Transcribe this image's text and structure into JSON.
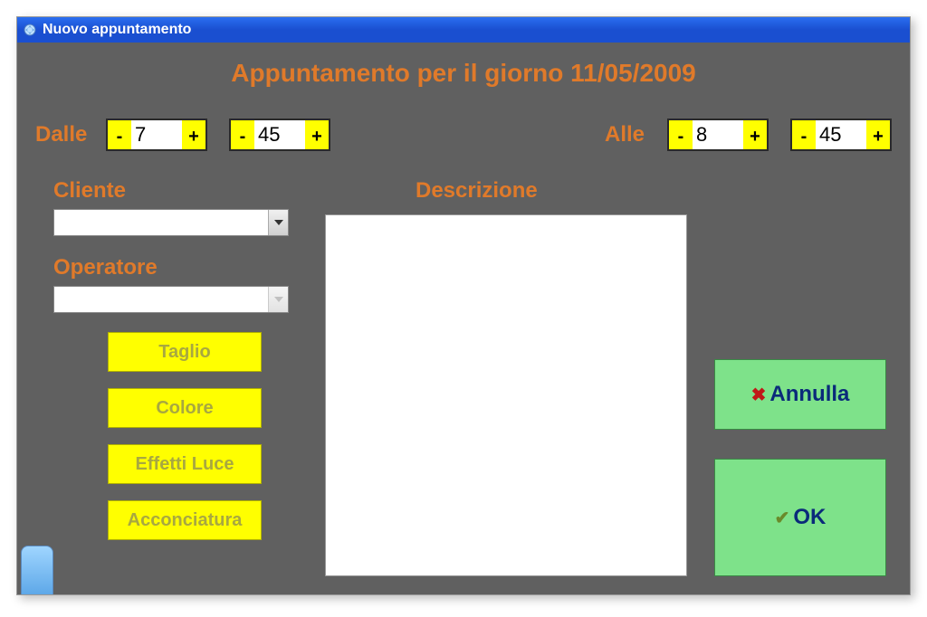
{
  "window": {
    "title": "Nuovo appuntamento"
  },
  "heading": "Appuntamento per il giorno 11/05/2009",
  "labels": {
    "dalle": "Dalle",
    "alle": "Alle",
    "cliente": "Cliente",
    "operatore": "Operatore",
    "descrizione": "Descrizione"
  },
  "time": {
    "from_hour": "7",
    "from_min": "45",
    "to_hour": "8",
    "to_min": "45"
  },
  "stepper": {
    "minus": "-",
    "plus": "+"
  },
  "cliente": {
    "value": ""
  },
  "operatore": {
    "value": ""
  },
  "descrizione": {
    "value": ""
  },
  "services": [
    "Taglio",
    "Colore",
    "Effetti Luce",
    "Acconciatura"
  ],
  "buttons": {
    "annulla": "Annulla",
    "ok": "OK"
  }
}
